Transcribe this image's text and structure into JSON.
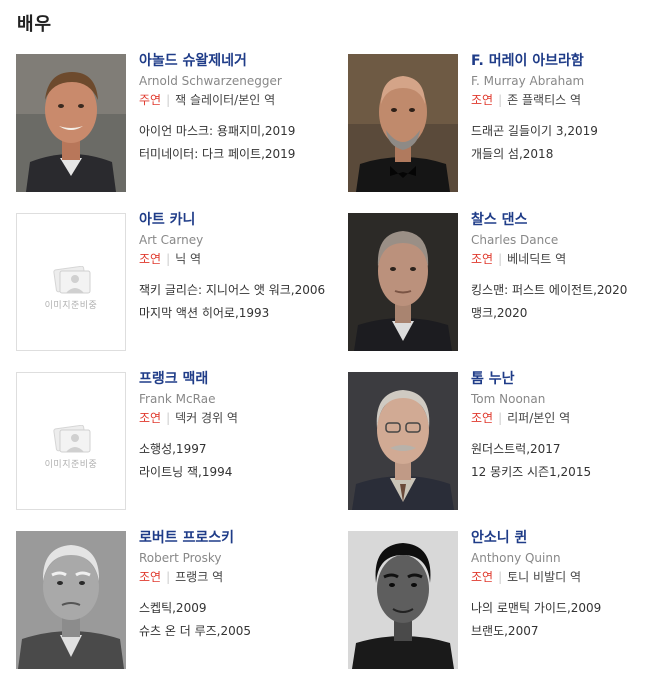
{
  "section": {
    "title": "배우"
  },
  "placeholder_text": "이미지준비중",
  "cast": [
    {
      "name_ko": "아놀드 슈왈제네거",
      "name_en": "Arnold Schwarzenegger",
      "role_type": "주연",
      "role": "잭 슬레이터/본인 역",
      "works": [
        "아이언 마스크: 용패지미,2019",
        "터미네이터: 다크 페이트,2019"
      ],
      "photo": "real"
    },
    {
      "name_ko": "F. 머레이 아브라함",
      "name_en": "F. Murray Abraham",
      "role_type": "조연",
      "role": "존 플랙티스 역",
      "works": [
        "드래곤 길들이기 3,2019",
        "개들의 섬,2018"
      ],
      "photo": "real"
    },
    {
      "name_ko": "아트 카니",
      "name_en": "Art Carney",
      "role_type": "조연",
      "role": "닉 역",
      "works": [
        "잭키 글리슨: 지니어스 앳 워크,2006",
        "마지막 액션 히어로,1993"
      ],
      "photo": "placeholder"
    },
    {
      "name_ko": "찰스 댄스",
      "name_en": "Charles Dance",
      "role_type": "조연",
      "role": "베네딕트 역",
      "works": [
        "킹스맨: 퍼스트 에이전트,2020",
        "맹크,2020"
      ],
      "photo": "real"
    },
    {
      "name_ko": "프랭크 맥래",
      "name_en": "Frank McRae",
      "role_type": "조연",
      "role": "덱커 경위 역",
      "works": [
        "소행성,1997",
        "라이트닝 잭,1994"
      ],
      "photo": "placeholder"
    },
    {
      "name_ko": "톰 누난",
      "name_en": "Tom Noonan",
      "role_type": "조연",
      "role": "리퍼/본인 역",
      "works": [
        "원더스트럭,2017",
        "12 몽키즈 시즌1,2015"
      ],
      "photo": "real"
    },
    {
      "name_ko": "로버트 프로스키",
      "name_en": "Robert Prosky",
      "role_type": "조연",
      "role": "프랭크 역",
      "works": [
        "스켑틱,2009",
        "슈츠 온 더 루즈,2005"
      ],
      "photo": "real"
    },
    {
      "name_ko": "안소니 퀸",
      "name_en": "Anthony Quinn",
      "role_type": "조연",
      "role": "토니 비발디 역",
      "works": [
        "나의 로맨틱 가이드,2009",
        "브랜도,2007"
      ],
      "photo": "real"
    }
  ]
}
